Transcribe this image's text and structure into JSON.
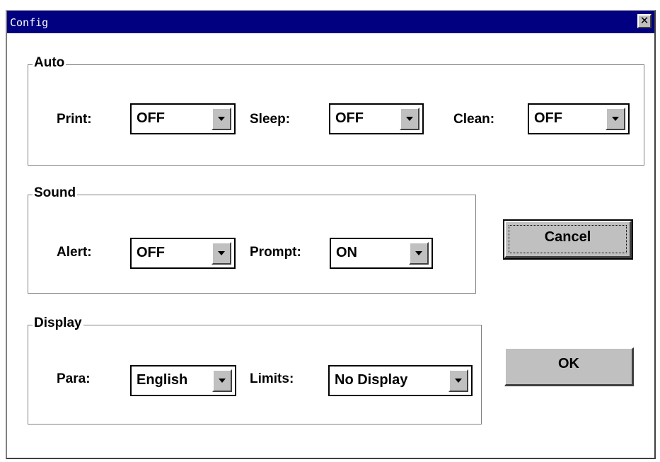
{
  "window": {
    "title": "Config",
    "close_glyph": "✕"
  },
  "auto": {
    "label": "Auto",
    "print": {
      "label": "Print:",
      "value": "OFF"
    },
    "sleep": {
      "label": "Sleep:",
      "value": "OFF"
    },
    "clean": {
      "label": "Clean:",
      "value": "OFF"
    }
  },
  "sound": {
    "label": "Sound",
    "alert": {
      "label": "Alert:",
      "value": "OFF"
    },
    "prompt": {
      "label": "Prompt:",
      "value": "ON"
    }
  },
  "display": {
    "label": "Display",
    "para": {
      "label": "Para:",
      "value": "English"
    },
    "limits": {
      "label": "Limits:",
      "value": "No Display"
    }
  },
  "buttons": {
    "cancel": "Cancel",
    "ok": "OK"
  },
  "colors": {
    "titlebar": "#000080",
    "face": "#c0c0c0"
  }
}
